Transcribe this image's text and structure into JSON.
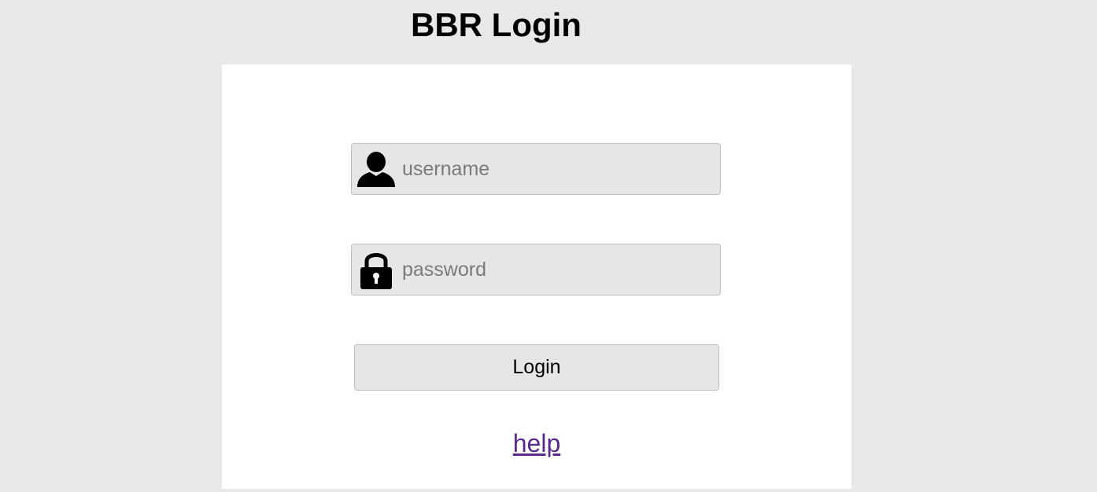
{
  "header": {
    "title": "BBR Login"
  },
  "form": {
    "username": {
      "icon": "user-icon",
      "placeholder": "username",
      "value": ""
    },
    "password": {
      "icon": "lock-icon",
      "placeholder": "password",
      "value": ""
    },
    "login_label": "Login",
    "help_label": "help"
  },
  "colors": {
    "page_background": "#e8e8e8",
    "panel_background": "#ffffff",
    "field_background": "#e6e6e6",
    "field_border": "#bdbdbd",
    "link": "#5a2a8a"
  }
}
